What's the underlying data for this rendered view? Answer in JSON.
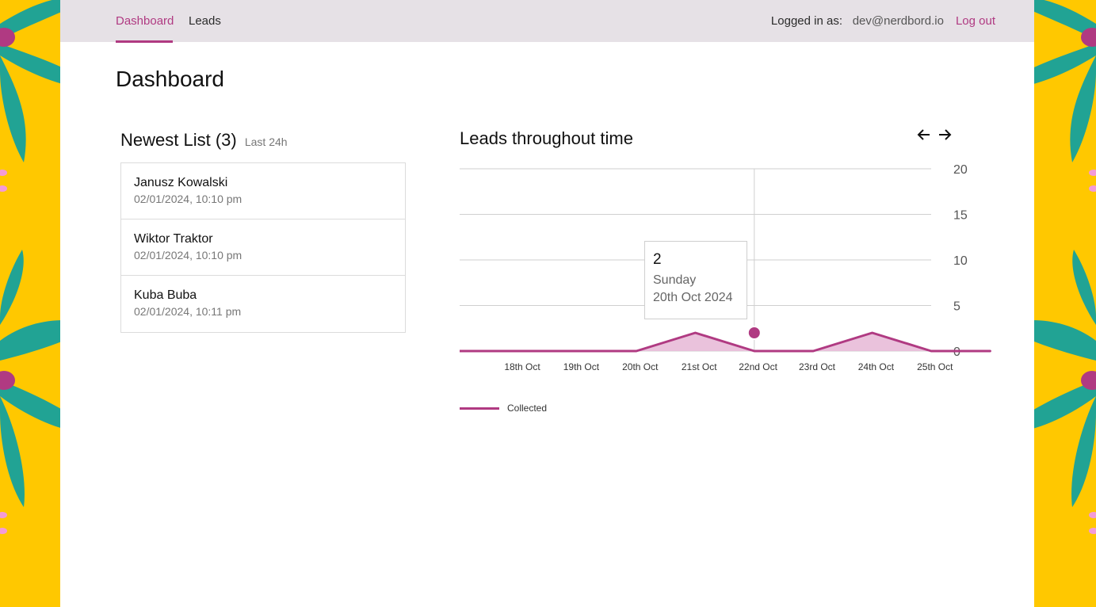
{
  "nav": {
    "items": [
      {
        "label": "Dashboard",
        "active": true
      },
      {
        "label": "Leads",
        "active": false
      }
    ],
    "logged_in_label": "Logged in as:",
    "email": "dev@nerdbord.io",
    "logout_label": "Log out"
  },
  "page": {
    "title": "Dashboard"
  },
  "newest_list": {
    "title": "Newest List (3)",
    "subtitle": "Last 24h",
    "items": [
      {
        "name": "Janusz Kowalski",
        "date": "02/01/2024, 10:10 pm"
      },
      {
        "name": "Wiktor Traktor",
        "date": "02/01/2024, 10:10 pm"
      },
      {
        "name": "Kuba Buba",
        "date": "02/01/2024, 10:11 pm"
      }
    ]
  },
  "chart_panel": {
    "title": "Leads throughout time",
    "prev_icon": "arrow-left-icon",
    "next_icon": "arrow-right-icon",
    "tooltip": {
      "value": "2",
      "day": "Sunday",
      "date": "20th Oct 2024"
    },
    "legend_label": "Collected"
  },
  "colors": {
    "accent": "#B03A82",
    "side_yellow": "#FFC800",
    "leaf_teal": "#21A394",
    "topbar": "#E6E1E6",
    "area_fill": "#E8BBD8"
  },
  "chart_data": {
    "type": "area",
    "categories": [
      "18th Oct",
      "19th Oct",
      "20th Oct",
      "21st Oct",
      "22nd Oct",
      "23rd Oct",
      "24th Oct",
      "25th Oct"
    ],
    "series": [
      {
        "name": "Collected",
        "x": [
          "18th Oct",
          "19th Oct",
          "20th Oct",
          "21st Oct",
          "22nd Oct",
          "23rd Oct",
          "24th Oct",
          "25th Oct"
        ],
        "values": [
          0,
          0,
          2,
          0,
          0,
          2,
          0,
          0
        ]
      }
    ],
    "ylim": [
      0,
      20
    ],
    "yticks": [
      0,
      5,
      10,
      15,
      20
    ],
    "yaxis_position": "right",
    "grid": true,
    "highlighted_category": "20th Oct",
    "legend": "bottom-left"
  }
}
